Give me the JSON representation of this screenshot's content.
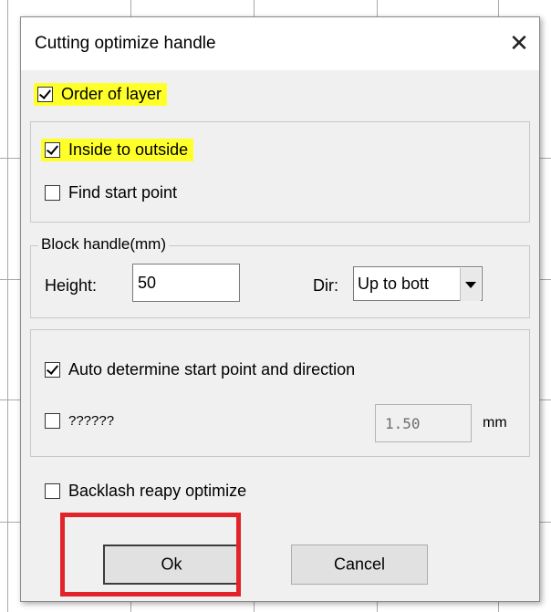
{
  "dialog": {
    "title": "Cutting optimize handle",
    "close_glyph": "✕"
  },
  "order_of_layer": {
    "label": "Order of layer",
    "checked": true,
    "highlight_color": "#ffff2a"
  },
  "inside_to_outside": {
    "label": "Inside to outside",
    "checked": true,
    "highlight_color": "#ffff2a"
  },
  "find_start_point": {
    "label": "Find start point",
    "checked": false
  },
  "block_handle": {
    "title": "Block handle(mm)",
    "height_label": "Height:",
    "height_value": "50",
    "dir_label": "Dir:",
    "dir_value": "Up to bott"
  },
  "auto_determine": {
    "label": "Auto determine start point and direction",
    "checked": true
  },
  "unknown_option": {
    "label": "??????",
    "checked": false,
    "value": "1.50",
    "unit": "mm"
  },
  "backlash": {
    "label": "Backlash reapy optimize",
    "checked": false
  },
  "buttons": {
    "ok_label": "Ok",
    "cancel_label": "Cancel"
  },
  "annotation": {
    "ok_outline_color": "#e2232a"
  }
}
